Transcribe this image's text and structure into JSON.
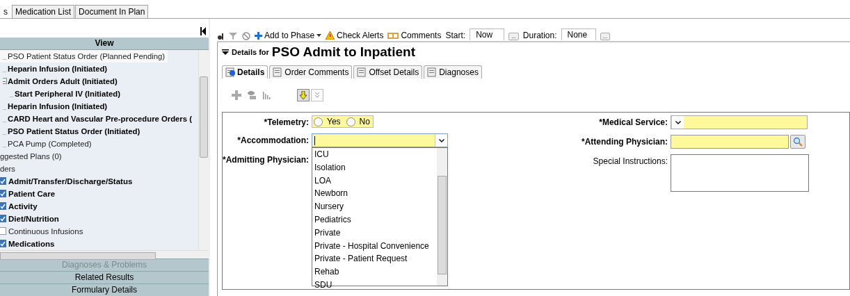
{
  "top_tabs": [
    {
      "label": "s",
      "selected": true
    },
    {
      "label": "Medication List",
      "selected": false
    },
    {
      "label": "Document In Plan",
      "selected": false
    }
  ],
  "sidebar": {
    "header": "View",
    "plans": [
      {
        "label": "PSO Patient Status Order (Planned Pending)",
        "active": false,
        "selected": true
      },
      {
        "label": "Heparin Infusion (Initiated)",
        "active": true,
        "selected": false
      },
      {
        "label": "Admit Orders Adult (Initiated)",
        "active": true,
        "selected": false,
        "expanded": true,
        "children": [
          {
            "label": "Start Peripheral IV (Initiated)",
            "active": true,
            "selected": false
          }
        ]
      },
      {
        "label": "Heparin Infusion (Initiated)",
        "active": true,
        "selected": false
      },
      {
        "label": "CARD Heart and Vascular Pre-procedure Orders (",
        "active": true,
        "selected": false
      },
      {
        "label": "PSO Patient Status Order (Initiated)",
        "active": true,
        "selected": false
      },
      {
        "label": "PCA Pump (Completed)",
        "active": false,
        "selected": false
      }
    ],
    "headings": [
      "ggested Plans (0)",
      "ders"
    ],
    "categories": [
      {
        "label": "Admit/Transfer/Discharge/Status",
        "checked": true
      },
      {
        "label": "Patient Care",
        "checked": true
      },
      {
        "label": "Activity",
        "checked": true
      },
      {
        "label": "Diet/Nutrition",
        "checked": true
      },
      {
        "label": "Continuous Infusions",
        "checked": false
      },
      {
        "label": "Medications",
        "checked": true
      }
    ],
    "sections": [
      {
        "label": "Diagnoses & Problems",
        "disabled": true
      },
      {
        "label": "Related Results",
        "disabled": false
      },
      {
        "label": "Formulary Details",
        "disabled": false
      }
    ]
  },
  "toolbar": {
    "add_to_phase": "Add to Phase",
    "check_alerts": "Check Alerts",
    "comments": "Comments",
    "start_label": "Start:",
    "start_value": "Now",
    "duration_label": "Duration:",
    "duration_value": "None",
    "more_button": "..."
  },
  "details": {
    "prefix": "Details for",
    "title": "PSO Admit to Inpatient",
    "tabs": [
      {
        "label": "Details",
        "selected": true
      },
      {
        "label": "Order Comments",
        "selected": false
      },
      {
        "label": "Offset Details",
        "selected": false
      },
      {
        "label": "Diagnoses",
        "selected": false
      }
    ],
    "left_fields": [
      {
        "kind": "radio",
        "label": "*Telemetry:",
        "required": true,
        "options": [
          {
            "label": "Yes",
            "selected": false
          },
          {
            "label": "No",
            "selected": false
          }
        ]
      },
      {
        "kind": "combo",
        "label": "*Accommodation:",
        "required": true,
        "expanded": true,
        "options": [
          "ICU",
          "Isolation",
          "LOA",
          "Newborn",
          "Nursery",
          "Pediatrics",
          "Private",
          "Private - Hospital Convenience",
          "Private - Patient Request",
          "Rehab",
          "SDU"
        ]
      },
      {
        "kind": "hidden",
        "label": "*Admitting Physician:",
        "required": true
      }
    ],
    "right_fields": [
      {
        "kind": "combo",
        "label": "*Medical Service:",
        "required": true
      },
      {
        "kind": "lookup",
        "label": "*Attending Physician:",
        "required": true
      },
      {
        "kind": "textarea",
        "label": "Special Instructions:",
        "required": false
      }
    ]
  }
}
